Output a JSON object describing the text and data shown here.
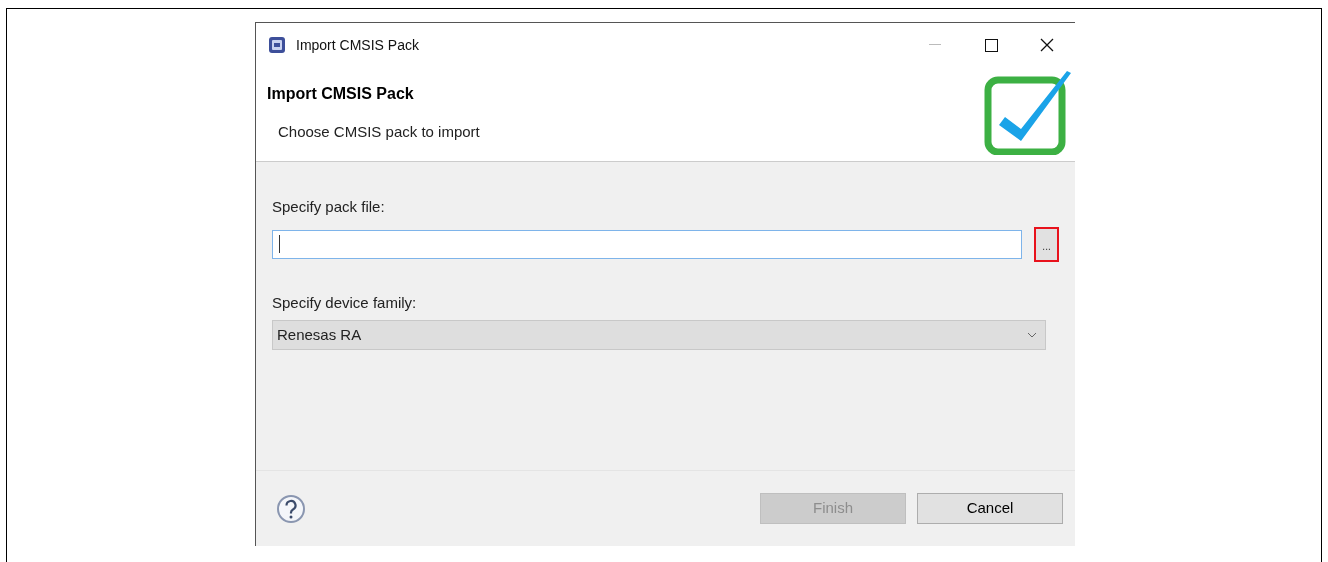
{
  "window": {
    "title": "Import CMSIS Pack"
  },
  "header": {
    "title": "Import CMSIS Pack",
    "subtitle": "Choose CMSIS pack to import"
  },
  "pack_file": {
    "label": "Specify pack file:",
    "browse_button": "...",
    "highlighted": true
  },
  "device_family": {
    "label": "Specify device family:",
    "value": "Renesas RA"
  },
  "buttons": [
    {
      "label": "Finish",
      "disabled": true
    },
    {
      "label": "Cancel",
      "disabled": false
    }
  ]
}
